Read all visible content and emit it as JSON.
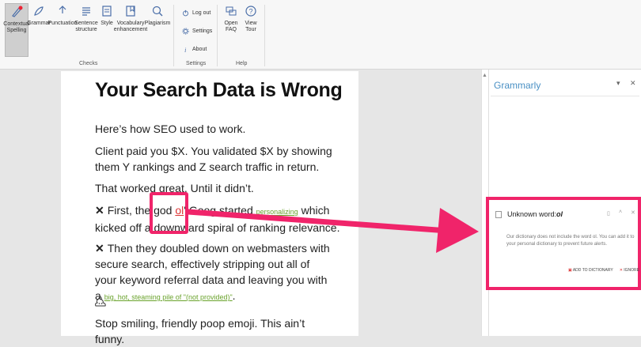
{
  "ribbon": {
    "checks": [
      {
        "label": "Contextual\nSpelling",
        "icon": "contextual-spelling-icon",
        "active": true
      },
      {
        "label": "Grammar",
        "icon": "grammar-icon"
      },
      {
        "label": "Punctuation",
        "icon": "punctuation-icon"
      },
      {
        "label": "Sentence\nstructure",
        "icon": "sentence-structure-icon"
      },
      {
        "label": "Style",
        "icon": "style-icon"
      },
      {
        "label": "Vocabulary\nenhancement",
        "icon": "vocabulary-icon"
      },
      {
        "label": "Plagiarism",
        "icon": "plagiarism-icon"
      }
    ],
    "checks_group": "Checks",
    "settings_items": [
      "Log out",
      "Settings",
      "About"
    ],
    "settings_group": "Settings",
    "help_items": [
      {
        "label": "Open\nFAQ",
        "icon": "faq-icon"
      },
      {
        "label": "View\nTour",
        "icon": "help-icon"
      }
    ],
    "help_group": "Help"
  },
  "document": {
    "title": "Your Search Data is Wrong",
    "p1": "Here’s how SEO used to work.",
    "p2": "Client paid you $X. You validated $X by showing them Y rankings and Z search traffic in return.",
    "p3": "That worked great. Until it didn’t.",
    "p4_a": "First, the g",
    "p4_b": "od ",
    "p4_err": "ol",
    "p4_c": "' Goog started ",
    "p4_link": "personalizing",
    "p4_d": " which",
    "p4_line2": "kicked off a downward spiral of ranking relevance.",
    "p5": "Then they doubled down on webmasters with secure search, effectively stripping out all of your keyword referral data and leaving you with a ",
    "p5_link": "big, hot, steaming pile of \"(not provided)\"",
    "p5_end": ".",
    "p6": "Stop smiling, friendly poop emoji. This ain’t funny."
  },
  "grammarly": {
    "title": "Grammarly",
    "card_title": "Unknown word: ",
    "card_word": "ol",
    "card_body": "Our dictionary does not include the word ol. You can add it to your personal dictionary to prevent future alerts.",
    "add_label": "ADD TO DICTIONARY",
    "ignore_label": "IGNORE"
  },
  "colors": {
    "accent": "#f0246a",
    "grammarly_blue": "#4a90c4",
    "link_green": "#6aa32c"
  }
}
